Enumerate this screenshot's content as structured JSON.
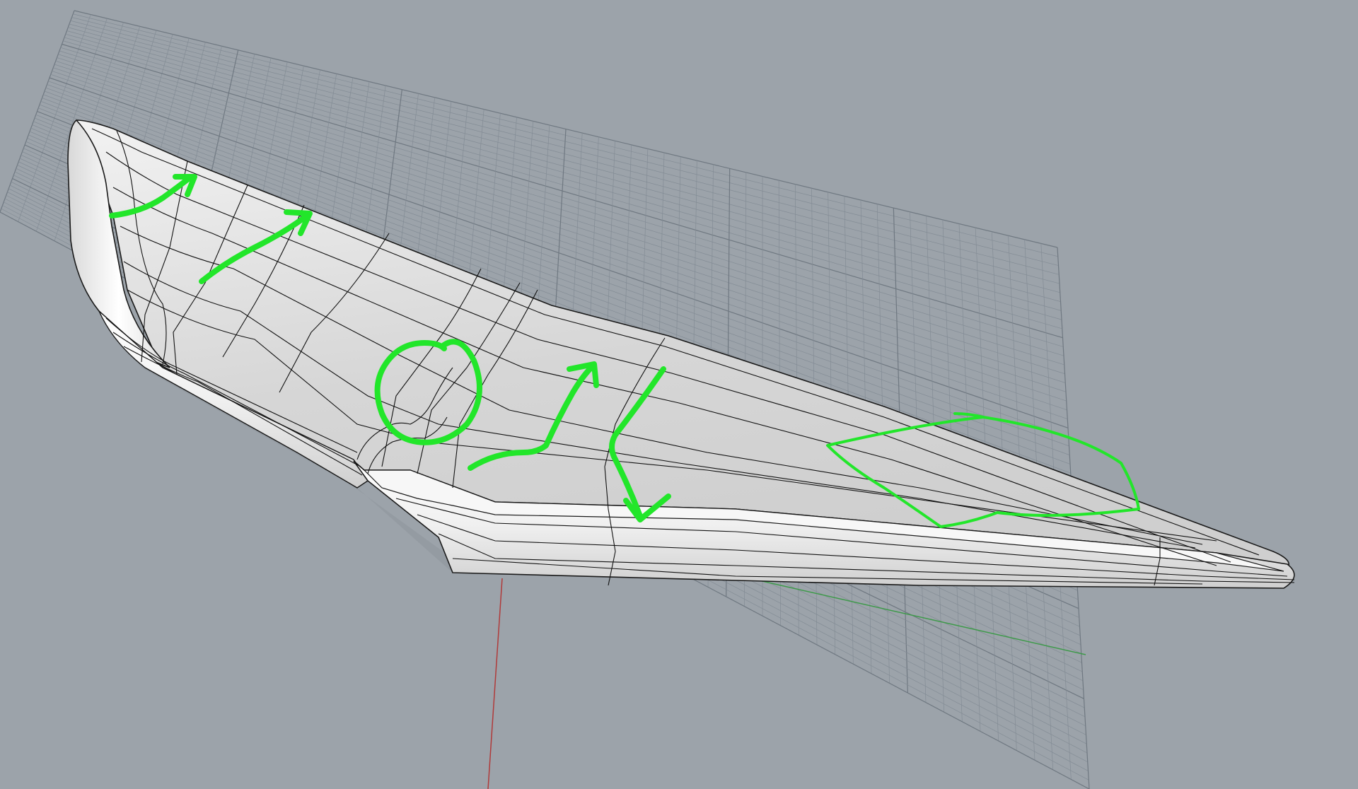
{
  "viewport": {
    "view": "perspective",
    "background_color": "#9ca3aa",
    "grid_color": "#838c95",
    "grid_major_color": "#6f7881",
    "axis_x_color": "#b03a3a",
    "axis_y_color": "#3e9a4a",
    "surface_color": "#e6e6e6",
    "isocurve_color": "#111111",
    "markup_color": "#22e62a"
  },
  "model": {
    "object": "wing-shaped-nurbs-surface",
    "display_mode": "shaded-with-isocurves"
  },
  "annotations": {
    "marks": [
      "arrow",
      "arrow",
      "circle",
      "arrow",
      "arrow",
      "outline"
    ]
  }
}
